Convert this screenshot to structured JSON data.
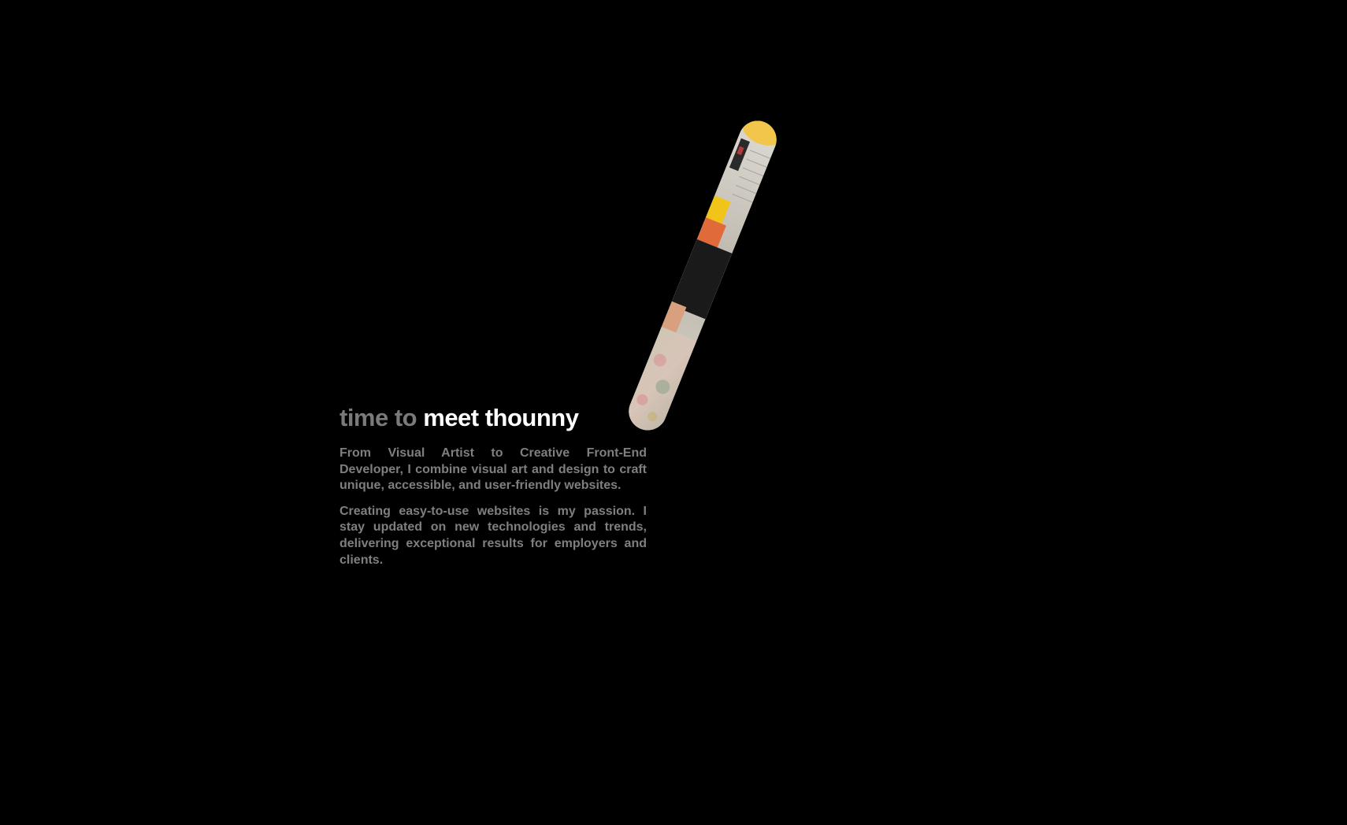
{
  "about": {
    "heading_muted": "time to",
    "heading_bright": "meet thounny",
    "paragraph_1": "From Visual Artist to Creative Front-End Developer, I combine visual art and design to craft unique, accessible, and user-friendly websites.",
    "paragraph_2": "Creating easy-to-use websites is my passion. I stay updated on new technologies and trends, delivering exceptional results for employers and clients."
  },
  "colors": {
    "background": "#000000",
    "heading_muted": "#7a7a7a",
    "heading_bright": "#ffffff",
    "body_text": "#7f7f7f",
    "photo_accent_yellow": "#f0c419"
  },
  "portrait": {
    "shape": "rounded-pill",
    "orientation": "tilted"
  }
}
